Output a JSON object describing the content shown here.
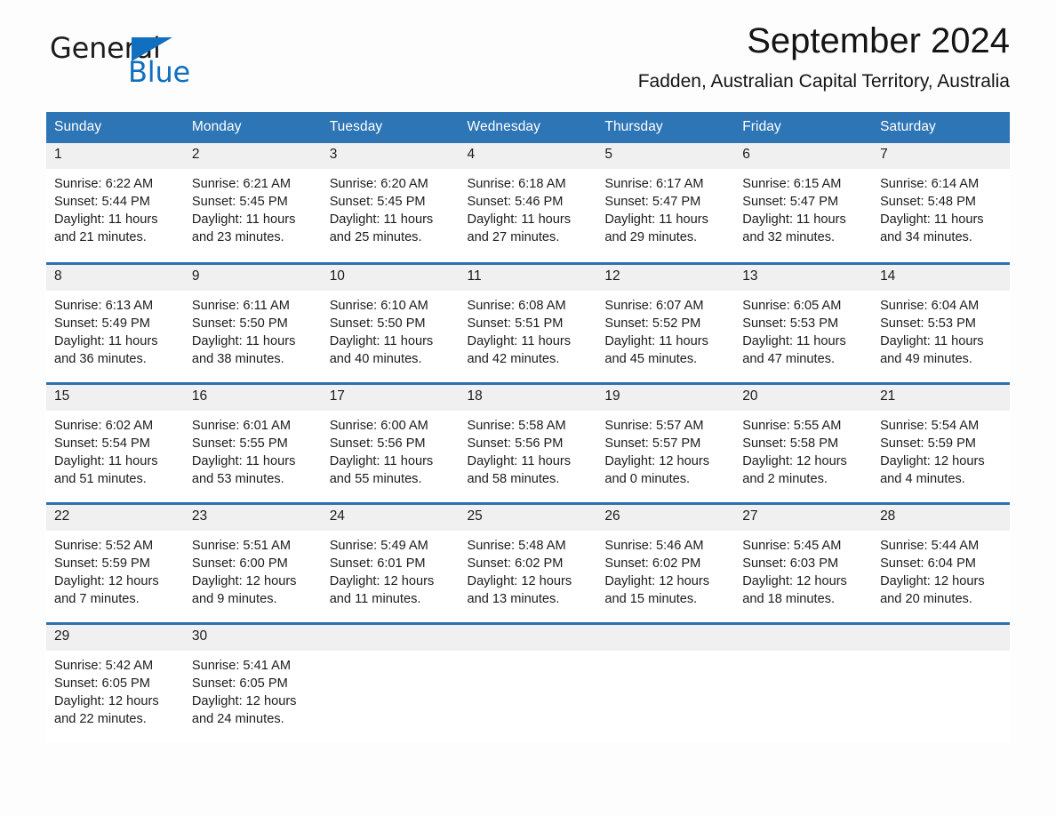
{
  "brand": {
    "name_part1": "General",
    "name_part2": "Blue",
    "accent_color": "#1070bf",
    "triangle_icon": "brand-triangle-icon"
  },
  "header": {
    "month_title": "September 2024",
    "location": "Fadden, Australian Capital Territory, Australia"
  },
  "calendar": {
    "header_bg": "#2e75b6",
    "row_border_color": "#2e6fab",
    "daynum_bg": "#f0f0f0",
    "weekday_headers": [
      "Sunday",
      "Monday",
      "Tuesday",
      "Wednesday",
      "Thursday",
      "Friday",
      "Saturday"
    ],
    "weeks": [
      {
        "days": [
          {
            "date": "1",
            "sunrise": "Sunrise: 6:22 AM",
            "sunset": "Sunset: 5:44 PM",
            "daylight": "Daylight: 11 hours and 21 minutes."
          },
          {
            "date": "2",
            "sunrise": "Sunrise: 6:21 AM",
            "sunset": "Sunset: 5:45 PM",
            "daylight": "Daylight: 11 hours and 23 minutes."
          },
          {
            "date": "3",
            "sunrise": "Sunrise: 6:20 AM",
            "sunset": "Sunset: 5:45 PM",
            "daylight": "Daylight: 11 hours and 25 minutes."
          },
          {
            "date": "4",
            "sunrise": "Sunrise: 6:18 AM",
            "sunset": "Sunset: 5:46 PM",
            "daylight": "Daylight: 11 hours and 27 minutes."
          },
          {
            "date": "5",
            "sunrise": "Sunrise: 6:17 AM",
            "sunset": "Sunset: 5:47 PM",
            "daylight": "Daylight: 11 hours and 29 minutes."
          },
          {
            "date": "6",
            "sunrise": "Sunrise: 6:15 AM",
            "sunset": "Sunset: 5:47 PM",
            "daylight": "Daylight: 11 hours and 32 minutes."
          },
          {
            "date": "7",
            "sunrise": "Sunrise: 6:14 AM",
            "sunset": "Sunset: 5:48 PM",
            "daylight": "Daylight: 11 hours and 34 minutes."
          }
        ]
      },
      {
        "days": [
          {
            "date": "8",
            "sunrise": "Sunrise: 6:13 AM",
            "sunset": "Sunset: 5:49 PM",
            "daylight": "Daylight: 11 hours and 36 minutes."
          },
          {
            "date": "9",
            "sunrise": "Sunrise: 6:11 AM",
            "sunset": "Sunset: 5:50 PM",
            "daylight": "Daylight: 11 hours and 38 minutes."
          },
          {
            "date": "10",
            "sunrise": "Sunrise: 6:10 AM",
            "sunset": "Sunset: 5:50 PM",
            "daylight": "Daylight: 11 hours and 40 minutes."
          },
          {
            "date": "11",
            "sunrise": "Sunrise: 6:08 AM",
            "sunset": "Sunset: 5:51 PM",
            "daylight": "Daylight: 11 hours and 42 minutes."
          },
          {
            "date": "12",
            "sunrise": "Sunrise: 6:07 AM",
            "sunset": "Sunset: 5:52 PM",
            "daylight": "Daylight: 11 hours and 45 minutes."
          },
          {
            "date": "13",
            "sunrise": "Sunrise: 6:05 AM",
            "sunset": "Sunset: 5:53 PM",
            "daylight": "Daylight: 11 hours and 47 minutes."
          },
          {
            "date": "14",
            "sunrise": "Sunrise: 6:04 AM",
            "sunset": "Sunset: 5:53 PM",
            "daylight": "Daylight: 11 hours and 49 minutes."
          }
        ]
      },
      {
        "days": [
          {
            "date": "15",
            "sunrise": "Sunrise: 6:02 AM",
            "sunset": "Sunset: 5:54 PM",
            "daylight": "Daylight: 11 hours and 51 minutes."
          },
          {
            "date": "16",
            "sunrise": "Sunrise: 6:01 AM",
            "sunset": "Sunset: 5:55 PM",
            "daylight": "Daylight: 11 hours and 53 minutes."
          },
          {
            "date": "17",
            "sunrise": "Sunrise: 6:00 AM",
            "sunset": "Sunset: 5:56 PM",
            "daylight": "Daylight: 11 hours and 55 minutes."
          },
          {
            "date": "18",
            "sunrise": "Sunrise: 5:58 AM",
            "sunset": "Sunset: 5:56 PM",
            "daylight": "Daylight: 11 hours and 58 minutes."
          },
          {
            "date": "19",
            "sunrise": "Sunrise: 5:57 AM",
            "sunset": "Sunset: 5:57 PM",
            "daylight": "Daylight: 12 hours and 0 minutes."
          },
          {
            "date": "20",
            "sunrise": "Sunrise: 5:55 AM",
            "sunset": "Sunset: 5:58 PM",
            "daylight": "Daylight: 12 hours and 2 minutes."
          },
          {
            "date": "21",
            "sunrise": "Sunrise: 5:54 AM",
            "sunset": "Sunset: 5:59 PM",
            "daylight": "Daylight: 12 hours and 4 minutes."
          }
        ]
      },
      {
        "days": [
          {
            "date": "22",
            "sunrise": "Sunrise: 5:52 AM",
            "sunset": "Sunset: 5:59 PM",
            "daylight": "Daylight: 12 hours and 7 minutes."
          },
          {
            "date": "23",
            "sunrise": "Sunrise: 5:51 AM",
            "sunset": "Sunset: 6:00 PM",
            "daylight": "Daylight: 12 hours and 9 minutes."
          },
          {
            "date": "24",
            "sunrise": "Sunrise: 5:49 AM",
            "sunset": "Sunset: 6:01 PM",
            "daylight": "Daylight: 12 hours and 11 minutes."
          },
          {
            "date": "25",
            "sunrise": "Sunrise: 5:48 AM",
            "sunset": "Sunset: 6:02 PM",
            "daylight": "Daylight: 12 hours and 13 minutes."
          },
          {
            "date": "26",
            "sunrise": "Sunrise: 5:46 AM",
            "sunset": "Sunset: 6:02 PM",
            "daylight": "Daylight: 12 hours and 15 minutes."
          },
          {
            "date": "27",
            "sunrise": "Sunrise: 5:45 AM",
            "sunset": "Sunset: 6:03 PM",
            "daylight": "Daylight: 12 hours and 18 minutes."
          },
          {
            "date": "28",
            "sunrise": "Sunrise: 5:44 AM",
            "sunset": "Sunset: 6:04 PM",
            "daylight": "Daylight: 12 hours and 20 minutes."
          }
        ]
      },
      {
        "days": [
          {
            "date": "29",
            "sunrise": "Sunrise: 5:42 AM",
            "sunset": "Sunset: 6:05 PM",
            "daylight": "Daylight: 12 hours and 22 minutes."
          },
          {
            "date": "30",
            "sunrise": "Sunrise: 5:41 AM",
            "sunset": "Sunset: 6:05 PM",
            "daylight": "Daylight: 12 hours and 24 minutes."
          },
          {
            "date": "",
            "sunrise": "",
            "sunset": "",
            "daylight": ""
          },
          {
            "date": "",
            "sunrise": "",
            "sunset": "",
            "daylight": ""
          },
          {
            "date": "",
            "sunrise": "",
            "sunset": "",
            "daylight": ""
          },
          {
            "date": "",
            "sunrise": "",
            "sunset": "",
            "daylight": ""
          },
          {
            "date": "",
            "sunrise": "",
            "sunset": "",
            "daylight": ""
          }
        ]
      }
    ]
  }
}
